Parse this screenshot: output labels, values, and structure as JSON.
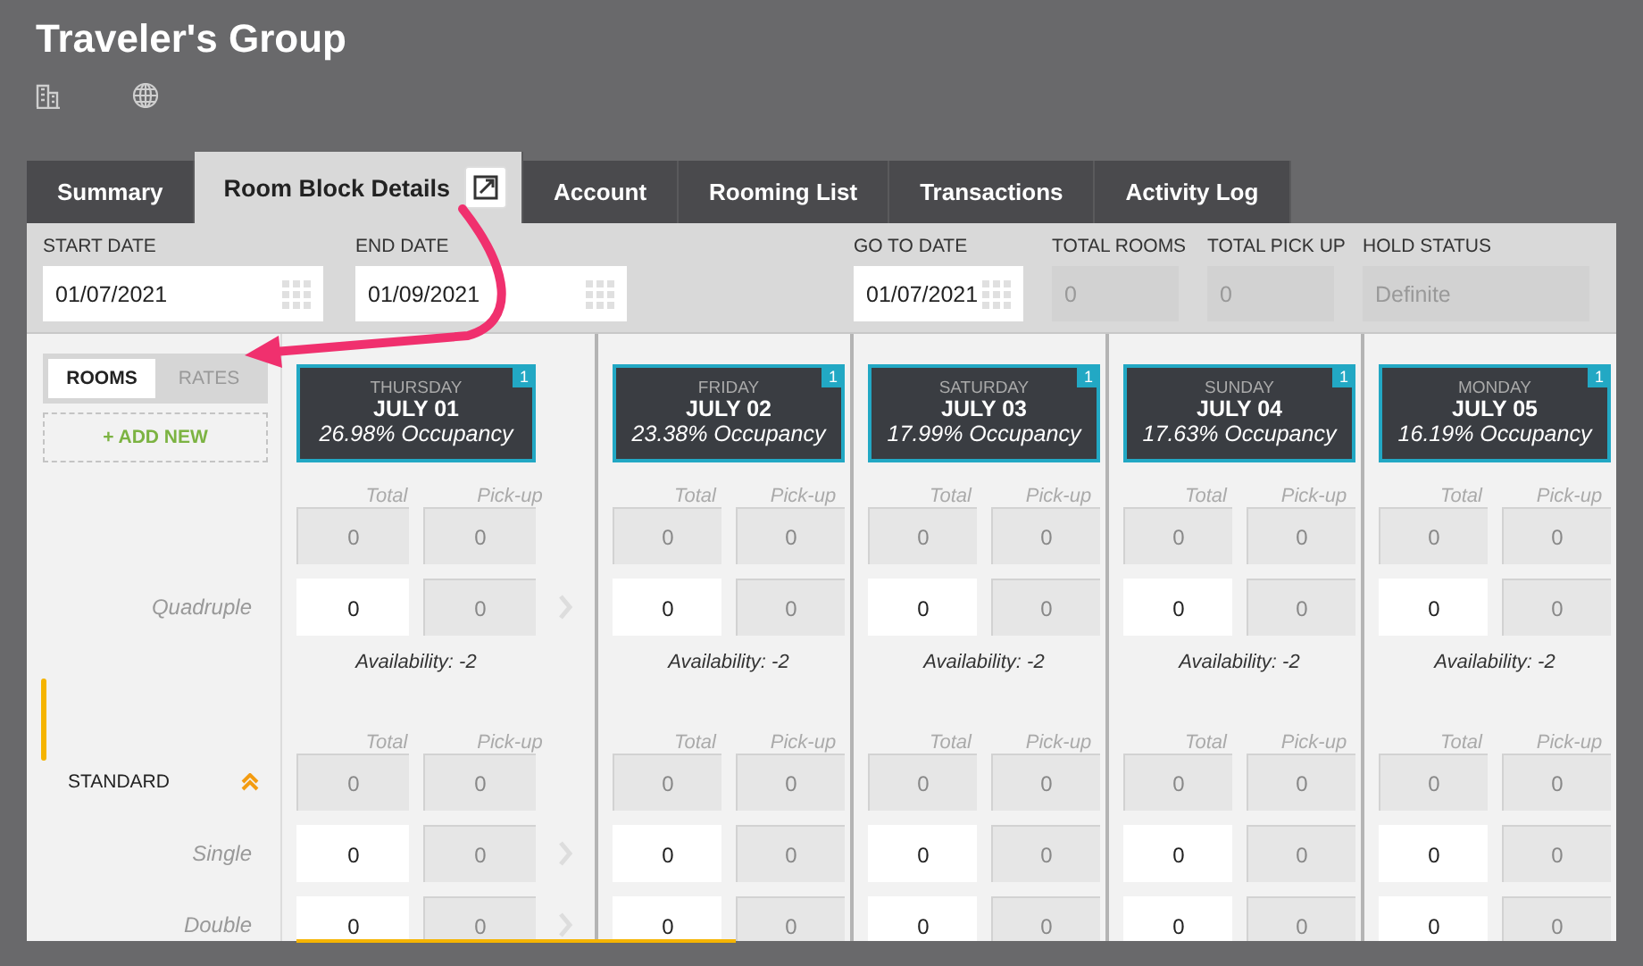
{
  "title": "Traveler's Group",
  "tabs": [
    {
      "label": "Summary",
      "selected": false
    },
    {
      "label": "Room Block Details",
      "selected": true,
      "editable": true
    },
    {
      "label": "Account",
      "selected": false
    },
    {
      "label": "Rooming List",
      "selected": false
    },
    {
      "label": "Transactions",
      "selected": false
    },
    {
      "label": "Activity Log",
      "selected": false
    }
  ],
  "fields": [
    {
      "label": "START DATE",
      "value": "01/07/2021",
      "kind": "date"
    },
    {
      "label": "END DATE",
      "value": "01/09/2021",
      "kind": "date"
    },
    {
      "label": "GO TO DATE",
      "value": "01/07/2021",
      "kind": "date"
    },
    {
      "label": "TOTAL ROOMS",
      "value": "0",
      "kind": "readonly"
    },
    {
      "label": "TOTAL PICK UP",
      "value": "0",
      "kind": "readonly"
    },
    {
      "label": "HOLD STATUS",
      "value": "Definite",
      "kind": "readonly"
    }
  ],
  "view_toggle": [
    {
      "label": "ROOMS",
      "selected": true
    },
    {
      "label": "RATES",
      "selected": false
    }
  ],
  "add_new": "+ ADD NEW",
  "rows": [
    {
      "kind": "header"
    },
    {
      "kind": "cells"
    },
    {
      "kind": "cells",
      "label": "Quadruple",
      "group": false,
      "arrow": true
    },
    {
      "kind": "availability"
    },
    {
      "kind": "header"
    },
    {
      "kind": "cells",
      "label": "STANDARD",
      "group": true
    },
    {
      "kind": "cells",
      "label": "Single",
      "group": false,
      "arrow": true
    },
    {
      "kind": "cells",
      "label": "Double",
      "group": false,
      "arrow": true
    }
  ],
  "days": [
    {
      "weekday": "THURSDAY",
      "date": "JULY 01",
      "occupancy": "26.98% Occupancy",
      "badge": "1",
      "cells": [
        {
          "total": "Total",
          "pickup": "Pick-up"
        },
        {
          "total": "0",
          "pickup": "0",
          "editable": false
        },
        {
          "total": "0",
          "pickup": "0",
          "editable": true
        },
        {
          "text": "Availability: -2"
        },
        {
          "total": "Total",
          "pickup": "Pick-up"
        },
        {
          "total": "0",
          "pickup": "0",
          "editable": false
        },
        {
          "total": "0",
          "pickup": "0",
          "editable": true
        },
        {
          "total": "0",
          "pickup": "0",
          "editable": true
        }
      ]
    },
    {
      "weekday": "FRIDAY",
      "date": "JULY 02",
      "occupancy": "23.38% Occupancy",
      "badge": "1",
      "cells": [
        {
          "total": "Total",
          "pickup": "Pick-up"
        },
        {
          "total": "0",
          "pickup": "0",
          "editable": false
        },
        {
          "total": "0",
          "pickup": "0",
          "editable": true
        },
        {
          "text": "Availability: -2"
        },
        {
          "total": "Total",
          "pickup": "Pick-up"
        },
        {
          "total": "0",
          "pickup": "0",
          "editable": false
        },
        {
          "total": "0",
          "pickup": "0",
          "editable": true
        },
        {
          "total": "0",
          "pickup": "0",
          "editable": true
        }
      ]
    },
    {
      "weekday": "SATURDAY",
      "date": "JULY 03",
      "occupancy": "17.99% Occupancy",
      "badge": "1",
      "cells": [
        {
          "total": "Total",
          "pickup": "Pick-up"
        },
        {
          "total": "0",
          "pickup": "0",
          "editable": false
        },
        {
          "total": "0",
          "pickup": "0",
          "editable": true
        },
        {
          "text": "Availability: -2"
        },
        {
          "total": "Total",
          "pickup": "Pick-up"
        },
        {
          "total": "0",
          "pickup": "0",
          "editable": false
        },
        {
          "total": "0",
          "pickup": "0",
          "editable": true
        },
        {
          "total": "0",
          "pickup": "0",
          "editable": true
        }
      ]
    },
    {
      "weekday": "SUNDAY",
      "date": "JULY 04",
      "occupancy": "17.63% Occupancy",
      "badge": "1",
      "cells": [
        {
          "total": "Total",
          "pickup": "Pick-up"
        },
        {
          "total": "0",
          "pickup": "0",
          "editable": false
        },
        {
          "total": "0",
          "pickup": "0",
          "editable": true
        },
        {
          "text": "Availability: -2"
        },
        {
          "total": "Total",
          "pickup": "Pick-up"
        },
        {
          "total": "0",
          "pickup": "0",
          "editable": false
        },
        {
          "total": "0",
          "pickup": "0",
          "editable": true
        },
        {
          "total": "0",
          "pickup": "0",
          "editable": true
        }
      ]
    },
    {
      "weekday": "MONDAY",
      "date": "JULY 05",
      "occupancy": "16.19% Occupancy",
      "badge": "1",
      "cells": [
        {
          "total": "Total",
          "pickup": "Pick-up"
        },
        {
          "total": "0",
          "pickup": "0",
          "editable": false
        },
        {
          "total": "0",
          "pickup": "0",
          "editable": true
        },
        {
          "text": "Availability: -2"
        },
        {
          "total": "Total",
          "pickup": "Pick-up"
        },
        {
          "total": "0",
          "pickup": "0",
          "editable": false
        },
        {
          "total": "0",
          "pickup": "0",
          "editable": true
        },
        {
          "total": "0",
          "pickup": "0",
          "editable": true
        }
      ]
    }
  ]
}
